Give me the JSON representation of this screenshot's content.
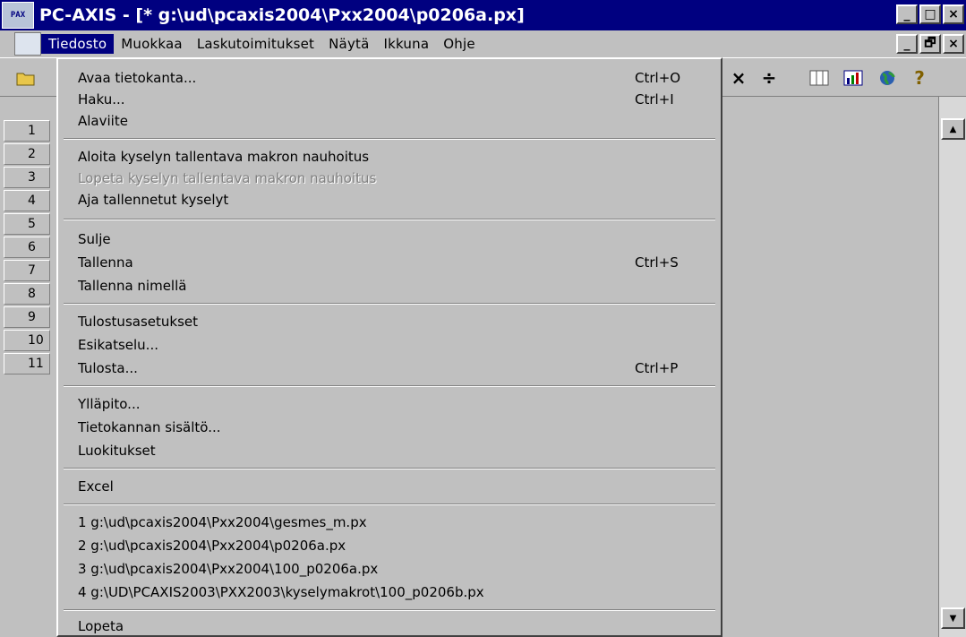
{
  "window": {
    "icon_label": "PAX",
    "title": "PC-AXIS - [* g:\\ud\\pcaxis2004\\Pxx2004\\p0206a.px]",
    "buttons": {
      "minimize": "_",
      "maximize": "□",
      "close": "×"
    }
  },
  "mdi_buttons": {
    "minimize": "_",
    "restore": "🗗",
    "close": "×"
  },
  "menubar": {
    "items": [
      "Tiedosto",
      "Muokkaa",
      "Laskutoimitukset",
      "Näytä",
      "Ikkuna",
      "Ohje"
    ]
  },
  "toolbar": {
    "multiply": "×",
    "divide": "÷",
    "help": "?"
  },
  "row_headers": [
    "1",
    "2",
    "3",
    "4",
    "5",
    "6",
    "7",
    "8",
    "9",
    "10",
    "11"
  ],
  "file_menu": {
    "open_database": {
      "label": "Avaa tietokanta...",
      "shortcut": "Ctrl+O"
    },
    "search": {
      "label": "Haku...",
      "shortcut": "Ctrl+I"
    },
    "footnote": {
      "label": "Alaviite"
    },
    "start_macro": {
      "label": "Aloita kyselyn tallentava makron nauhoitus"
    },
    "stop_macro": {
      "label": "Lopeta kyselyn tallentava makron nauhoitus"
    },
    "run_queries": {
      "label": "Aja tallennetut kyselyt"
    },
    "close": {
      "label": "Sulje"
    },
    "save": {
      "label": "Tallenna",
      "shortcut": "Ctrl+S"
    },
    "save_as": {
      "label": "Tallenna nimellä"
    },
    "print_setup": {
      "label": "Tulostusasetukset"
    },
    "print_preview": {
      "label": "Esikatselu..."
    },
    "print": {
      "label": "Tulosta...",
      "shortcut": "Ctrl+P"
    },
    "maintenance": {
      "label": "Ylläpito..."
    },
    "db_contents": {
      "label": "Tietokannan sisältö..."
    },
    "classifications": {
      "label": "Luokitukset"
    },
    "excel": {
      "label": "Excel"
    },
    "recent": [
      "1 g:\\ud\\pcaxis2004\\Pxx2004\\gesmes_m.px",
      "2 g:\\ud\\pcaxis2004\\Pxx2004\\p0206a.px",
      "3 g:\\ud\\pcaxis2004\\Pxx2004\\100_p0206a.px",
      "4 g:\\UD\\PCAXIS2003\\PXX2003\\kyselymakrot\\100_p0206b.px"
    ],
    "exit": {
      "label": "Lopeta"
    }
  },
  "colors": {
    "title_bar": "#000080",
    "face": "#c0c0c0",
    "highlight": "#000080"
  }
}
